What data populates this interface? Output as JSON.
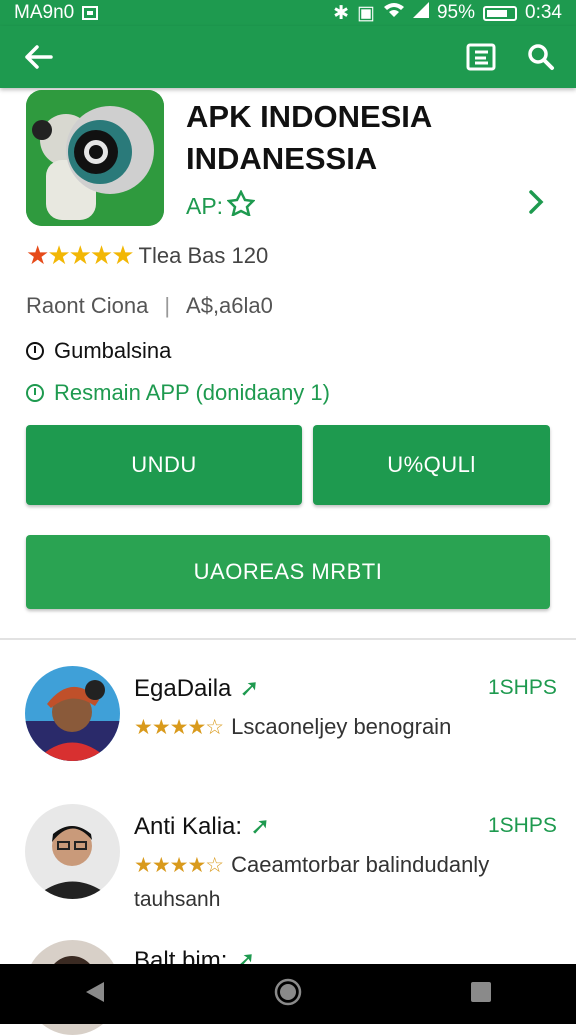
{
  "status_bar": {
    "carrier": "MA9n0",
    "battery": "95%",
    "time": "0:34"
  },
  "app_bar": {
    "back_icon": "arrow-left-icon",
    "menu_icon": "list-icon",
    "search_icon": "search-icon"
  },
  "app": {
    "title_line1": "APK INDONESIA",
    "title_line2": "INDANESSIA",
    "developer": "AP:",
    "rating_text": "Tlea Bas 120",
    "meta_left": "Raont Ciona",
    "meta_right": "A$,a6la0",
    "info1": "Gumbalsina",
    "info2": "Resmain APP (donidaany  1)"
  },
  "buttons": {
    "undu": "UNDU",
    "right": "U%QULl",
    "wide": "UAOREAS MRBTI"
  },
  "reviews": [
    {
      "name": "EgaDaila",
      "badge": "1SHPS",
      "text": "Lscaoneljey benograin",
      "text2": ""
    },
    {
      "name": "Anti Kalia:",
      "badge": "1SHPS",
      "text": "Caeamtorbar balindudanly",
      "text2": "tauhsanh"
    },
    {
      "name": "Balt bim:",
      "badge": "",
      "text": "",
      "text2": ""
    }
  ],
  "colors": {
    "primary": "#1e9a4f",
    "star": "#f2b705"
  }
}
